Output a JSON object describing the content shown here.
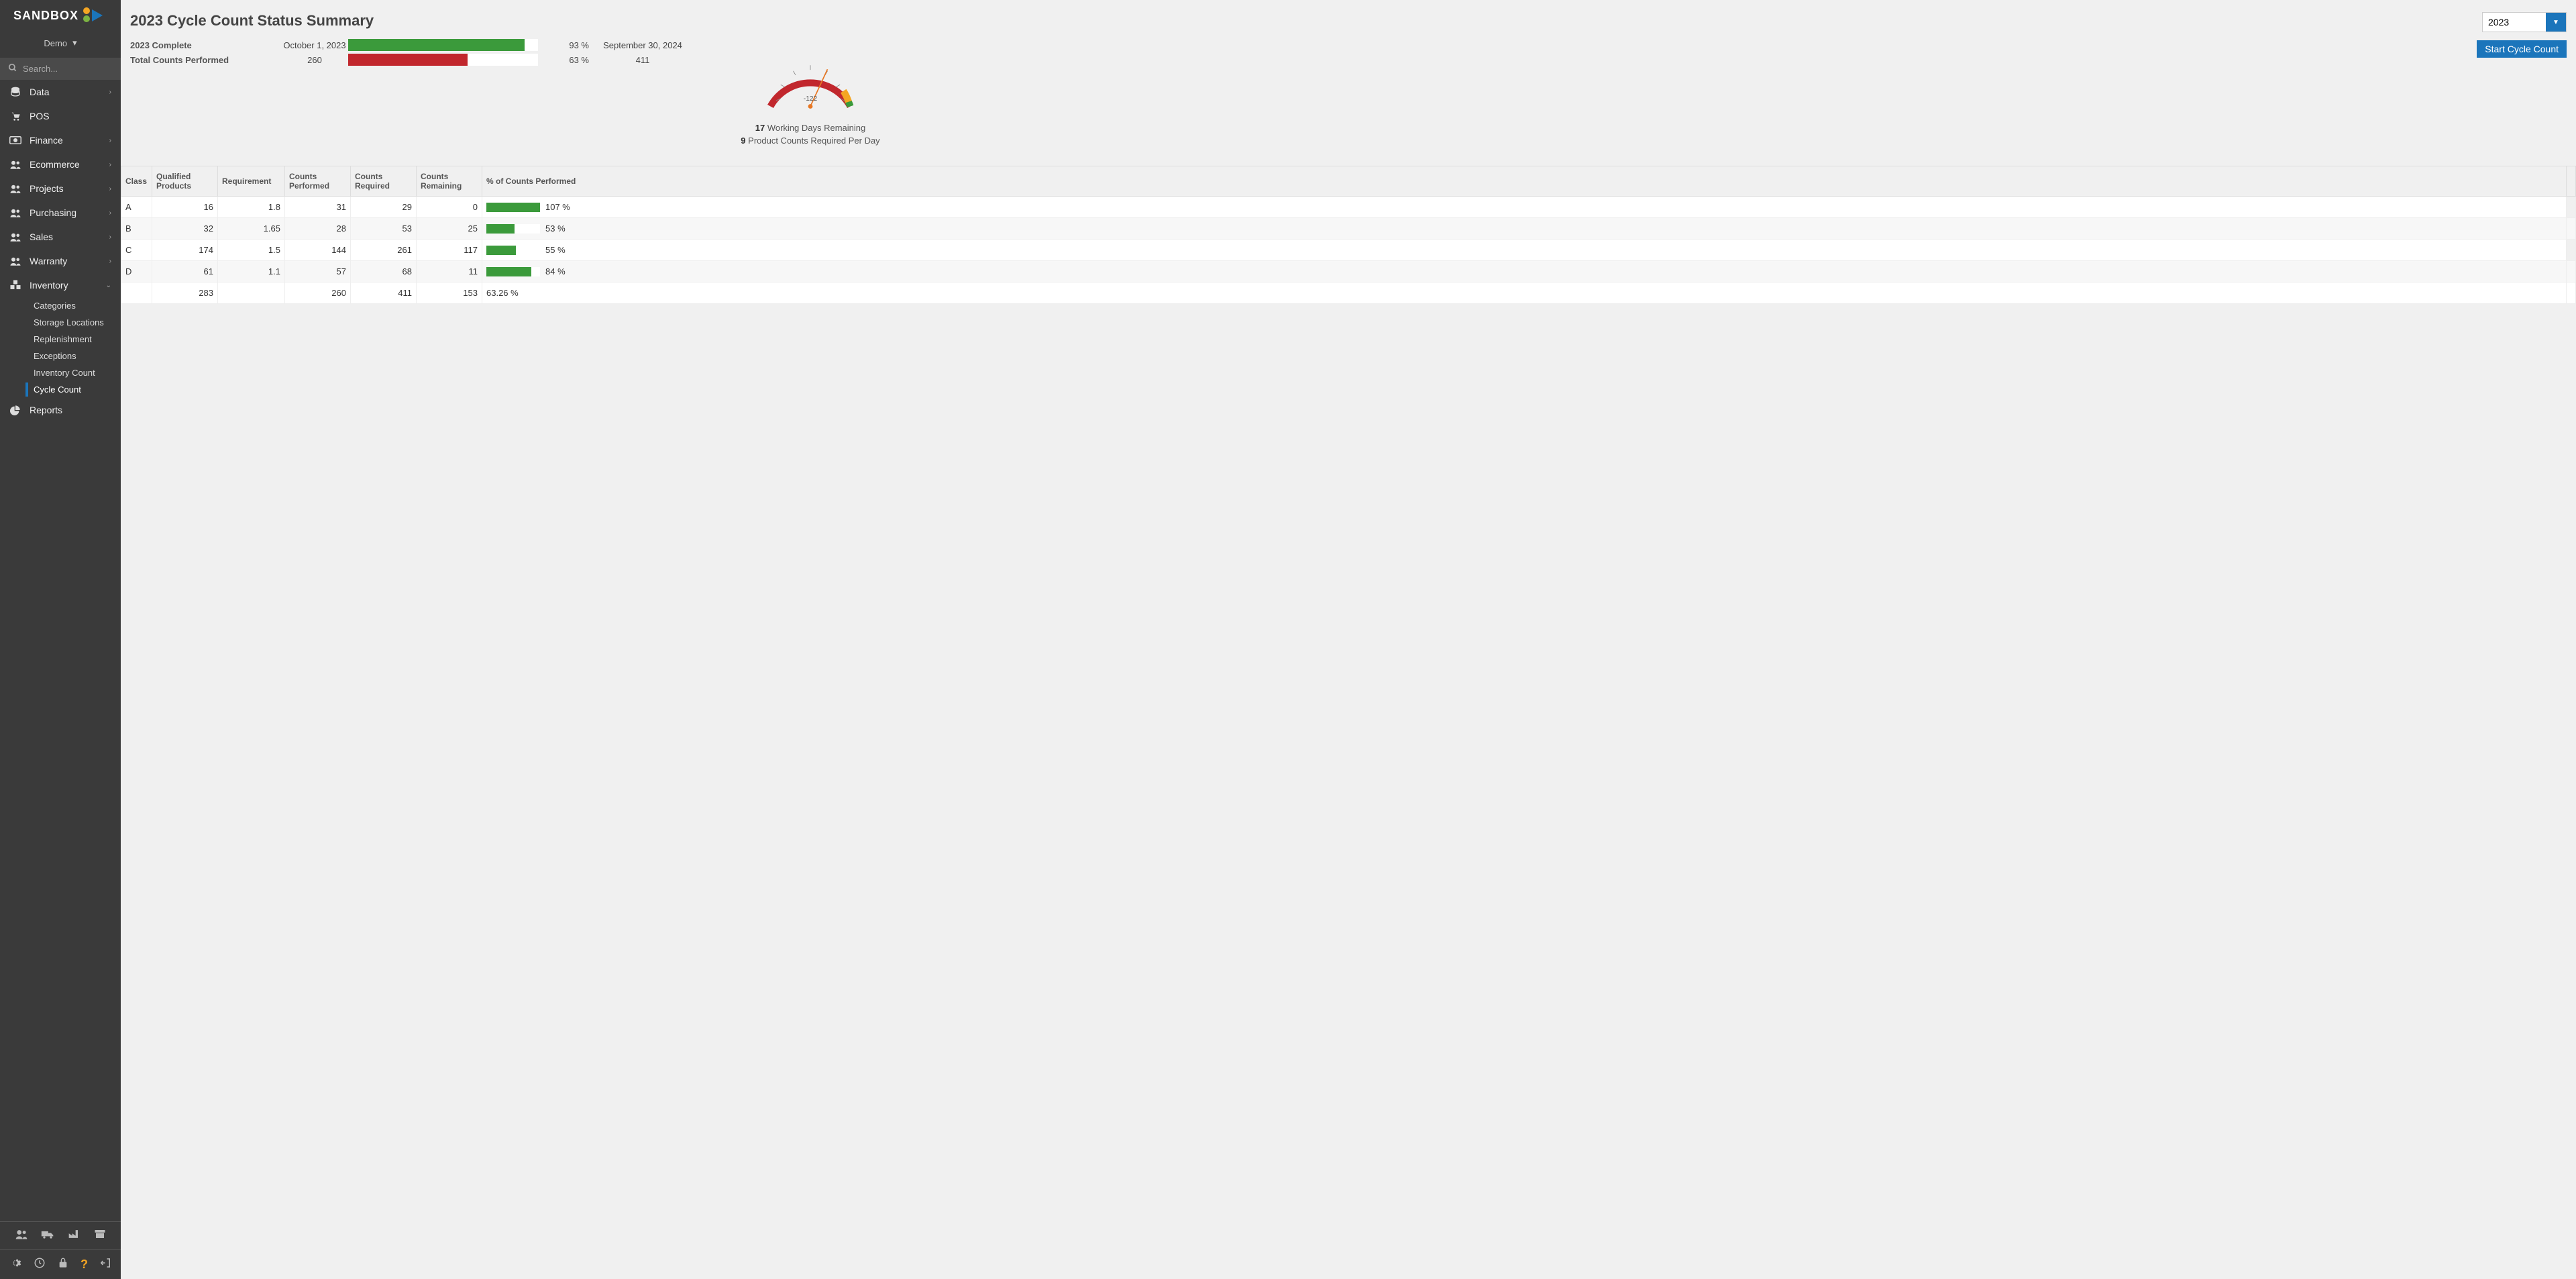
{
  "brand": "SANDBOX",
  "tenant": "Demo",
  "search": {
    "placeholder": "Search..."
  },
  "nav": {
    "data": "Data",
    "pos": "POS",
    "finance": "Finance",
    "ecommerce": "Ecommerce",
    "projects": "Projects",
    "purchasing": "Purchasing",
    "sales": "Sales",
    "warranty": "Warranty",
    "inventory": "Inventory",
    "reports": "Reports",
    "inv_sub": {
      "categories": "Categories",
      "storage": "Storage Locations",
      "replenishment": "Replenishment",
      "exceptions": "Exceptions",
      "inventory_count": "Inventory Count",
      "cycle_count": "Cycle Count"
    }
  },
  "page_title": "2023 Cycle Count Status Summary",
  "summary": {
    "row1": {
      "label": "2023 Complete",
      "value": "October 1, 2023",
      "pct": "93 %",
      "bar_pct": 93,
      "bar_color": "#3b9a3b",
      "extra": "September 30, 2024"
    },
    "row2": {
      "label": "Total Counts Performed",
      "value": "260",
      "pct": "63 %",
      "bar_pct": 63,
      "bar_color": "#c1272d",
      "extra": "411"
    }
  },
  "gauge": {
    "value": "-122",
    "line1a": "17",
    "line1b": " Working Days Remaining",
    "line2a": "9",
    "line2b": " Product Counts Required Per Day"
  },
  "year_value": "2023",
  "start_btn": "Start Cycle Count",
  "table": {
    "headers": {
      "class": "Class",
      "qualified": "Qualified Products",
      "requirement": "Requirement",
      "performed": "Counts Performed",
      "required": "Counts Required",
      "remaining": "Counts Remaining",
      "pct_performed": "% of Counts Performed"
    },
    "rows": [
      {
        "class": "A",
        "qp": "16",
        "req": "1.8",
        "cp": "31",
        "cr": "29",
        "crem": "0",
        "pct": "107 %",
        "bar": 100
      },
      {
        "class": "B",
        "qp": "32",
        "req": "1.65",
        "cp": "28",
        "cr": "53",
        "crem": "25",
        "pct": "53 %",
        "bar": 53
      },
      {
        "class": "C",
        "qp": "174",
        "req": "1.5",
        "cp": "144",
        "cr": "261",
        "crem": "117",
        "pct": "55 %",
        "bar": 55
      },
      {
        "class": "D",
        "qp": "61",
        "req": "1.1",
        "cp": "57",
        "cr": "68",
        "crem": "11",
        "pct": "84 %",
        "bar": 84
      }
    ],
    "total": {
      "qp": "283",
      "cp": "260",
      "cr": "411",
      "crem": "153",
      "pct": "63.26 %"
    }
  },
  "chart_data": {
    "type": "table",
    "title": "2023 Cycle Count Status Summary",
    "columns": [
      "Class",
      "Qualified Products",
      "Requirement",
      "Counts Performed",
      "Counts Required",
      "Counts Remaining",
      "% of Counts Performed"
    ],
    "rows": [
      [
        "A",
        16,
        1.8,
        31,
        29,
        0,
        107
      ],
      [
        "B",
        32,
        1.65,
        28,
        53,
        25,
        53
      ],
      [
        "C",
        174,
        1.5,
        144,
        261,
        117,
        55
      ],
      [
        "D",
        61,
        1.1,
        57,
        68,
        11,
        84
      ]
    ],
    "totals": {
      "Qualified Products": 283,
      "Counts Performed": 260,
      "Counts Required": 411,
      "Counts Remaining": 153,
      "% of Counts Performed": 63.26
    }
  }
}
